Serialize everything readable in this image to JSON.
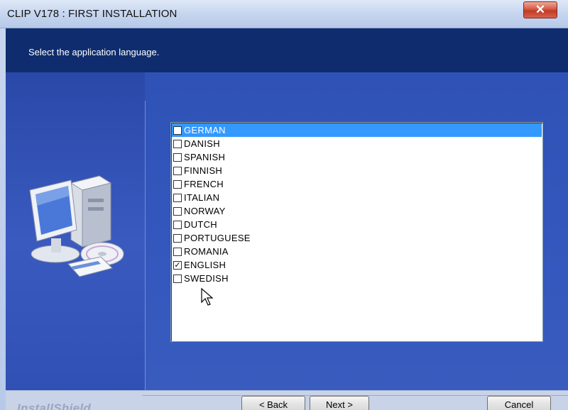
{
  "window": {
    "title": "CLIP V178 : FIRST INSTALLATION",
    "close_glyph": "✕"
  },
  "header": {
    "instruction": "Select the application language."
  },
  "languages": [
    {
      "label": "GERMAN",
      "checked": false,
      "selected": true
    },
    {
      "label": "DANISH",
      "checked": false,
      "selected": false
    },
    {
      "label": "SPANISH",
      "checked": false,
      "selected": false
    },
    {
      "label": "FINNISH",
      "checked": false,
      "selected": false
    },
    {
      "label": "FRENCH",
      "checked": false,
      "selected": false
    },
    {
      "label": "ITALIAN",
      "checked": false,
      "selected": false
    },
    {
      "label": "NORWAY",
      "checked": false,
      "selected": false
    },
    {
      "label": "DUTCH",
      "checked": false,
      "selected": false
    },
    {
      "label": "PORTUGUESE",
      "checked": false,
      "selected": false
    },
    {
      "label": "ROMANIA",
      "checked": false,
      "selected": false
    },
    {
      "label": "ENGLISH",
      "checked": true,
      "selected": false
    },
    {
      "label": "SWEDISH",
      "checked": false,
      "selected": false
    }
  ],
  "footer": {
    "brand": "InstallShield",
    "back_label": "< Back",
    "next_label": "Next >",
    "cancel_label": "Cancel"
  },
  "colors": {
    "header_bg": "#0f2d6e",
    "panel_bg": "#3458bd",
    "selection": "#3399ff"
  }
}
